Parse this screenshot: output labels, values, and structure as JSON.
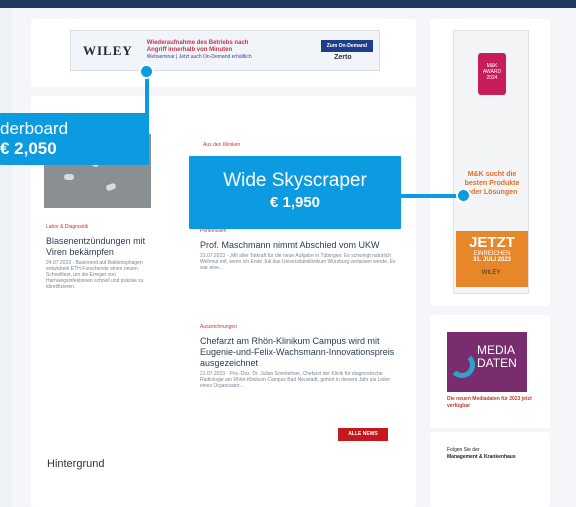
{
  "leaderboard_ad": {
    "brand": "WILEY",
    "headline": "Wiederaufnahme des Betriebs nach",
    "subline": "Angriff innerhalb von Minuten",
    "sub2": "Webseminar | Jetzt auch On-Demand erhältlich",
    "button": "Zum On-Demand",
    "logo": "Zerto"
  },
  "sky_ad": {
    "badge": "M&K AWARD 2024",
    "text": "M&K sucht die besten Produkte oder Lösungen",
    "cta_main": "JETZT",
    "cta_sub": "EINREICHEN",
    "cta_date": "31. JULI 2023",
    "brand": "WILEY"
  },
  "media_ad": {
    "title_line1": "MEDIA",
    "title_line2": "DATEN",
    "caption": "Die neuen Mediadaten für 2023 jetzt verfügbar"
  },
  "follow": {
    "line1": "Folgen Sie der",
    "line2": "Management & Krankenhaus"
  },
  "articles": {
    "left": {
      "tag": "Labor & Diagnostik",
      "title": "Blasenentzündungen mit Viren bekämpfen",
      "meta": "24.07.2023 · Basierend auf Bakteriophagen entwickeln ETH-Forschende einen neuen Schnelltest, um die Erreger von Harnwegsinfektionen schnell und präzise zu identifizieren."
    },
    "center_tag": "Aus den Kliniken",
    "a1": {
      "tag": "Personalien",
      "title": "Prof. Maschmann nimmt Abschied vom UKW",
      "meta": "21.07.2023 · „Mit aller Tatkraft für die neue Aufgabe in Tübingen: Es schwingt natürlich Wehmut mit, wenn ich Ende Juli das Universitätsklinikum Würzburg verlassen werde. Es war eine..."
    },
    "a2": {
      "tag": "Auszeichnungen",
      "title": "Chefarzt am Rhön-Klinikum Campus wird mit Eugenie-und-Felix-Wachsmann-Innovationspreis ausgezeichnet",
      "meta": "21.07.2023 · Priv.-Doz. Dr. Julian Sonnleitner, Chefarzt der Klinik für diagnostische Radiologie am Rhön-Klinikum Campus Bad Neustadt, gehört in diesem Jahr als Leiter eines Organisator..."
    },
    "all_news": "ALLE NEWS",
    "hintergrund": "Hintergrund"
  },
  "callouts": {
    "leaderboard": {
      "label": "derboard",
      "price": "€ 2,050"
    },
    "skyscraper": {
      "label": "Wide Skyscraper",
      "price": "€ 1,950"
    }
  },
  "colors": {
    "callout": "#0c9ae0",
    "accent_red": "#c4171e",
    "navy": "#1f3a5c"
  }
}
